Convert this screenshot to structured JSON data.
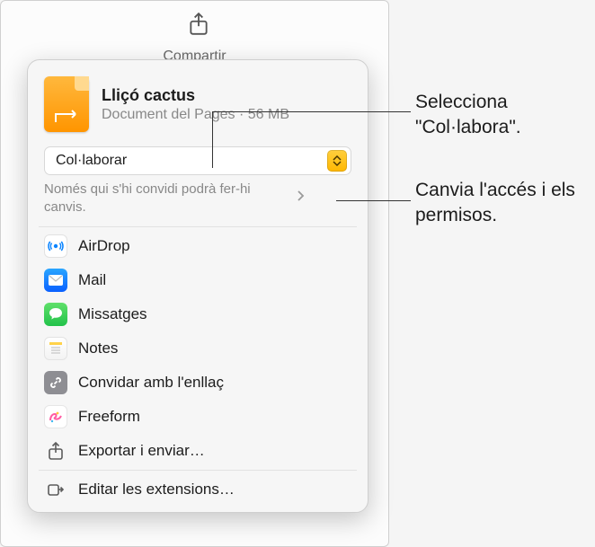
{
  "toolbar": {
    "share_label": "Compartir"
  },
  "popover": {
    "doc_title": "Lliçó cactus",
    "doc_meta": "Document del Pages · 56 MB",
    "mode_label": "Col·laborar",
    "perm_text": "Només qui s'hi convidi podrà fer-hi canvis.",
    "items": [
      {
        "label": "AirDrop",
        "icon": "airdrop-icon"
      },
      {
        "label": "Mail",
        "icon": "mail-icon"
      },
      {
        "label": "Missatges",
        "icon": "messages-icon"
      },
      {
        "label": "Notes",
        "icon": "notes-icon"
      },
      {
        "label": "Convidar amb l'enllaç",
        "icon": "link-icon"
      },
      {
        "label": "Freeform",
        "icon": "freeform-icon"
      },
      {
        "label": "Exportar i enviar…",
        "icon": "export-icon"
      }
    ],
    "edit_extensions": "Editar les extensions…"
  },
  "callouts": {
    "c1": "Selecciona \"Col·labora\".",
    "c2": "Canvia l'accés i els permisos."
  }
}
